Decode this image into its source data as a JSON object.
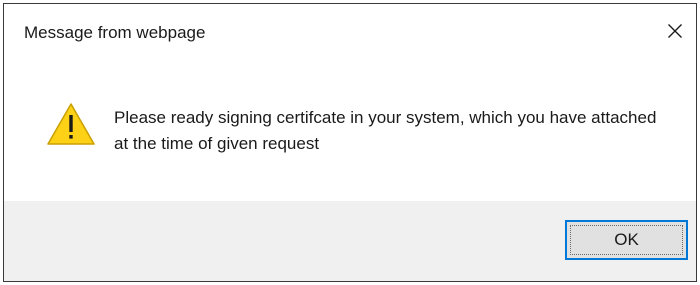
{
  "dialog": {
    "title": "Message from webpage",
    "message": "Please ready signing certifcate in your system, which you have attached at the time of given request",
    "icon": "warning-icon",
    "ok_label": "OK",
    "close_icon": "close-icon"
  },
  "colors": {
    "accent": "#0078d7",
    "warning_fill": "#fcd116",
    "footer_bg": "#f0f0f0"
  }
}
